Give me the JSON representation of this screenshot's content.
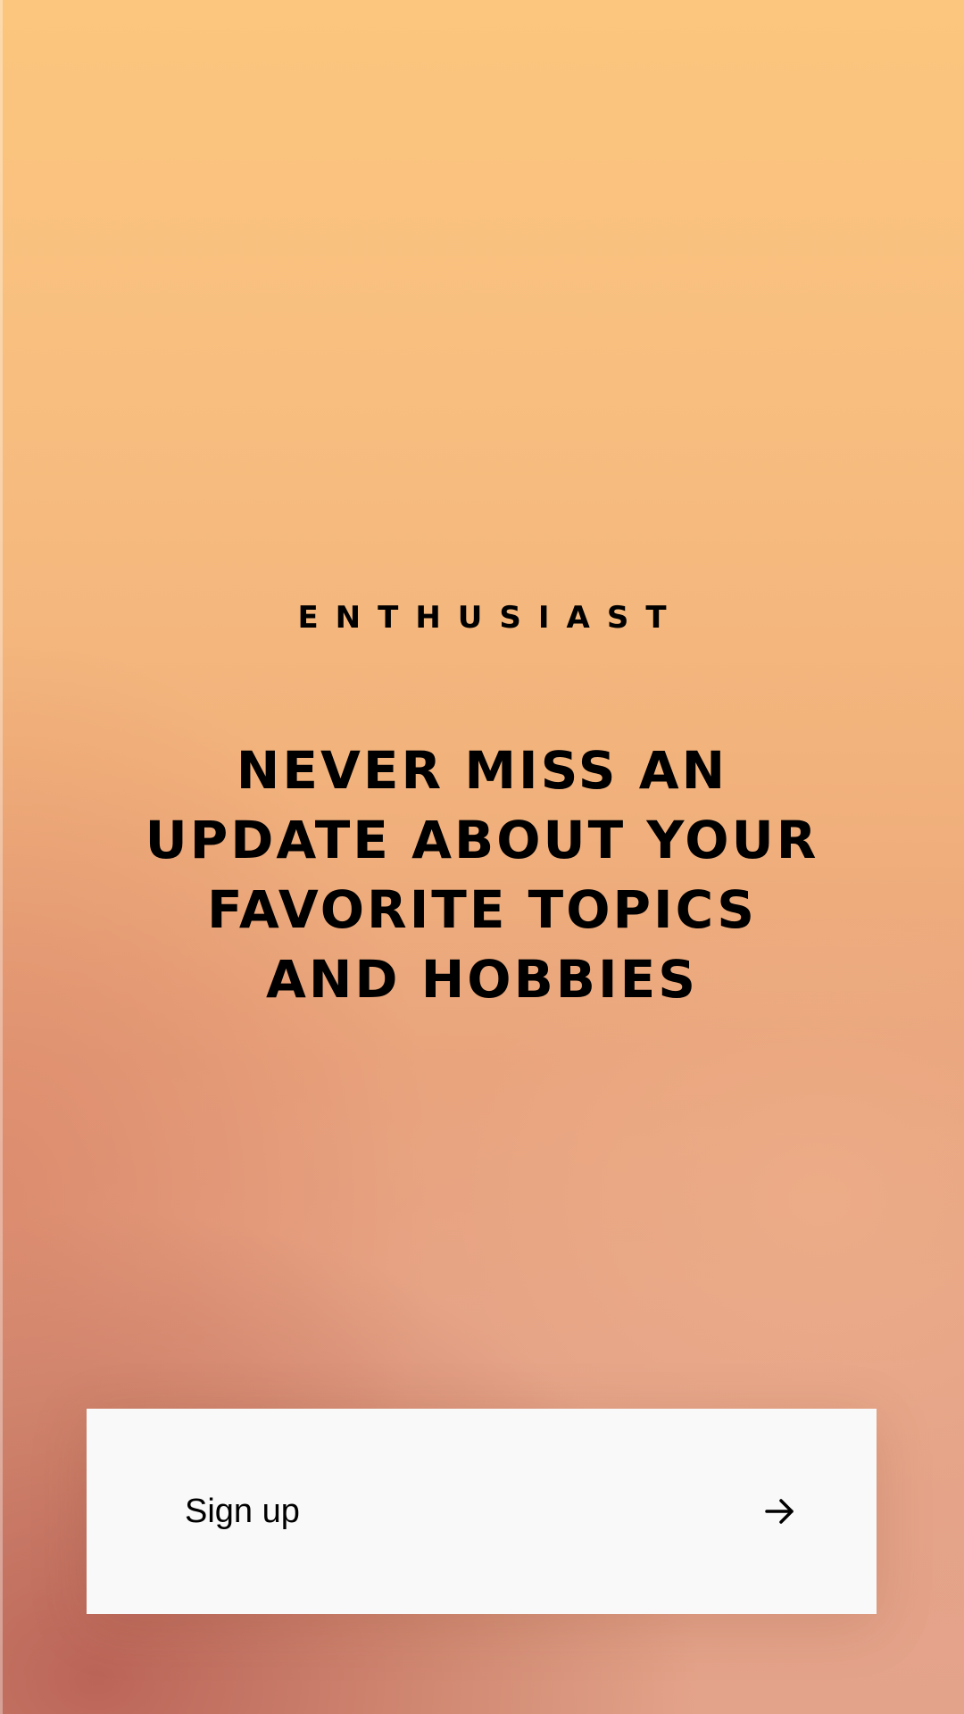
{
  "app": {
    "brand": "ENTHUSIAST"
  },
  "hero": {
    "headline": "Never miss an update about your favorite topics and hobbies"
  },
  "cta": {
    "label": "Sign up",
    "icon": "arrow-right-icon"
  },
  "colors": {
    "background_top": "#fcc67e",
    "background_bottom_left": "#c06a5c",
    "button_background": "#f9f9f9",
    "text": "#000000"
  }
}
